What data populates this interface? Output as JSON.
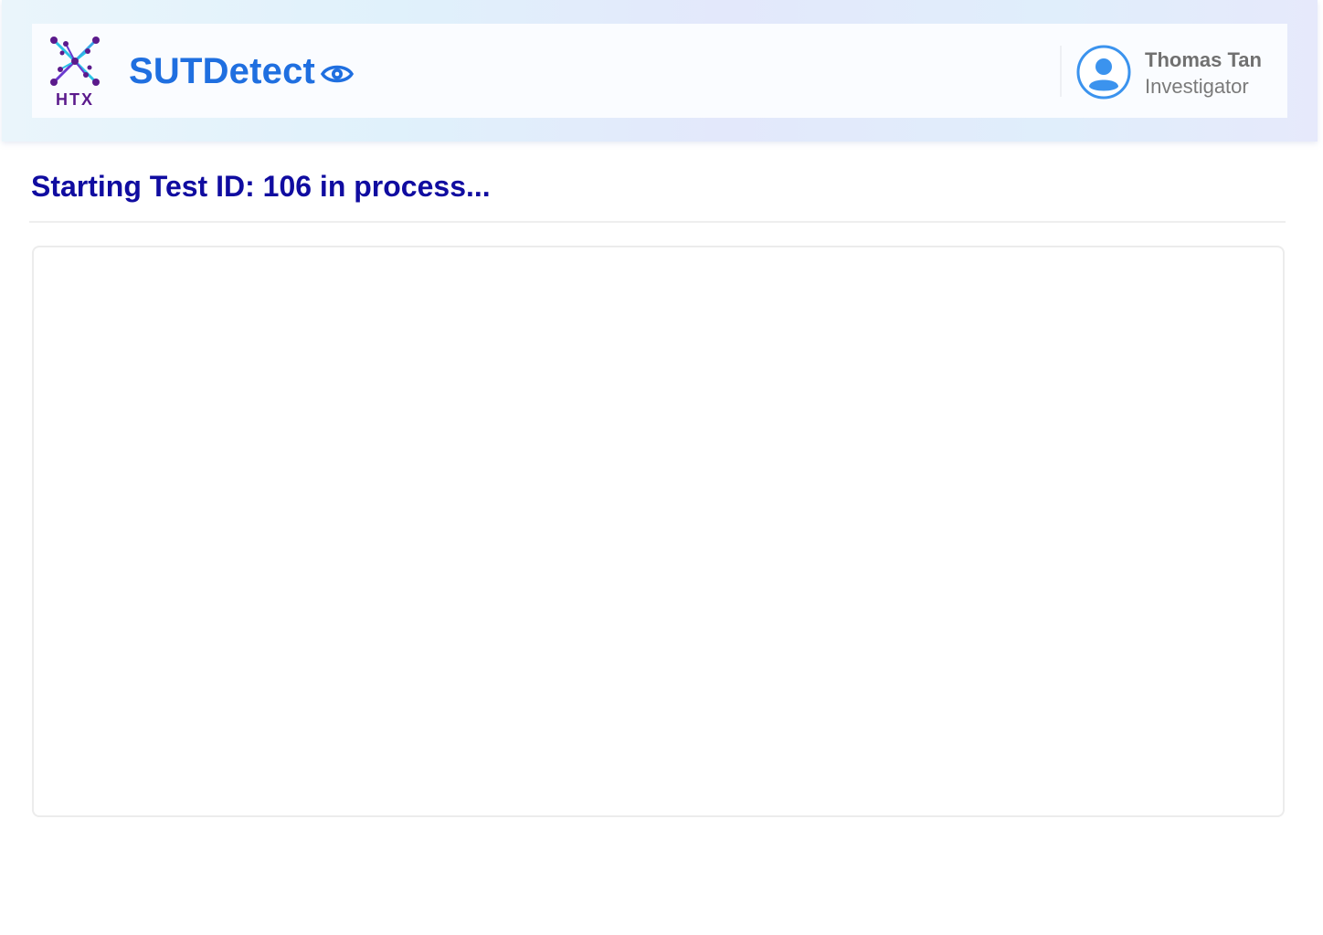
{
  "header": {
    "logo_text": "HTX",
    "app_title": "SUTDetect",
    "title_icon": "eye-icon",
    "user": {
      "avatar_icon": "user-avatar-icon",
      "name": "Thomas Tan",
      "role": "Investigator"
    }
  },
  "main": {
    "heading": "Starting Test ID: 106 in process..."
  },
  "colors": {
    "brand_blue": "#1f6fe0",
    "heading_navy": "#100ca0",
    "logo_purple": "#5b1a8c",
    "logo_cyan": "#2bc3e6"
  }
}
